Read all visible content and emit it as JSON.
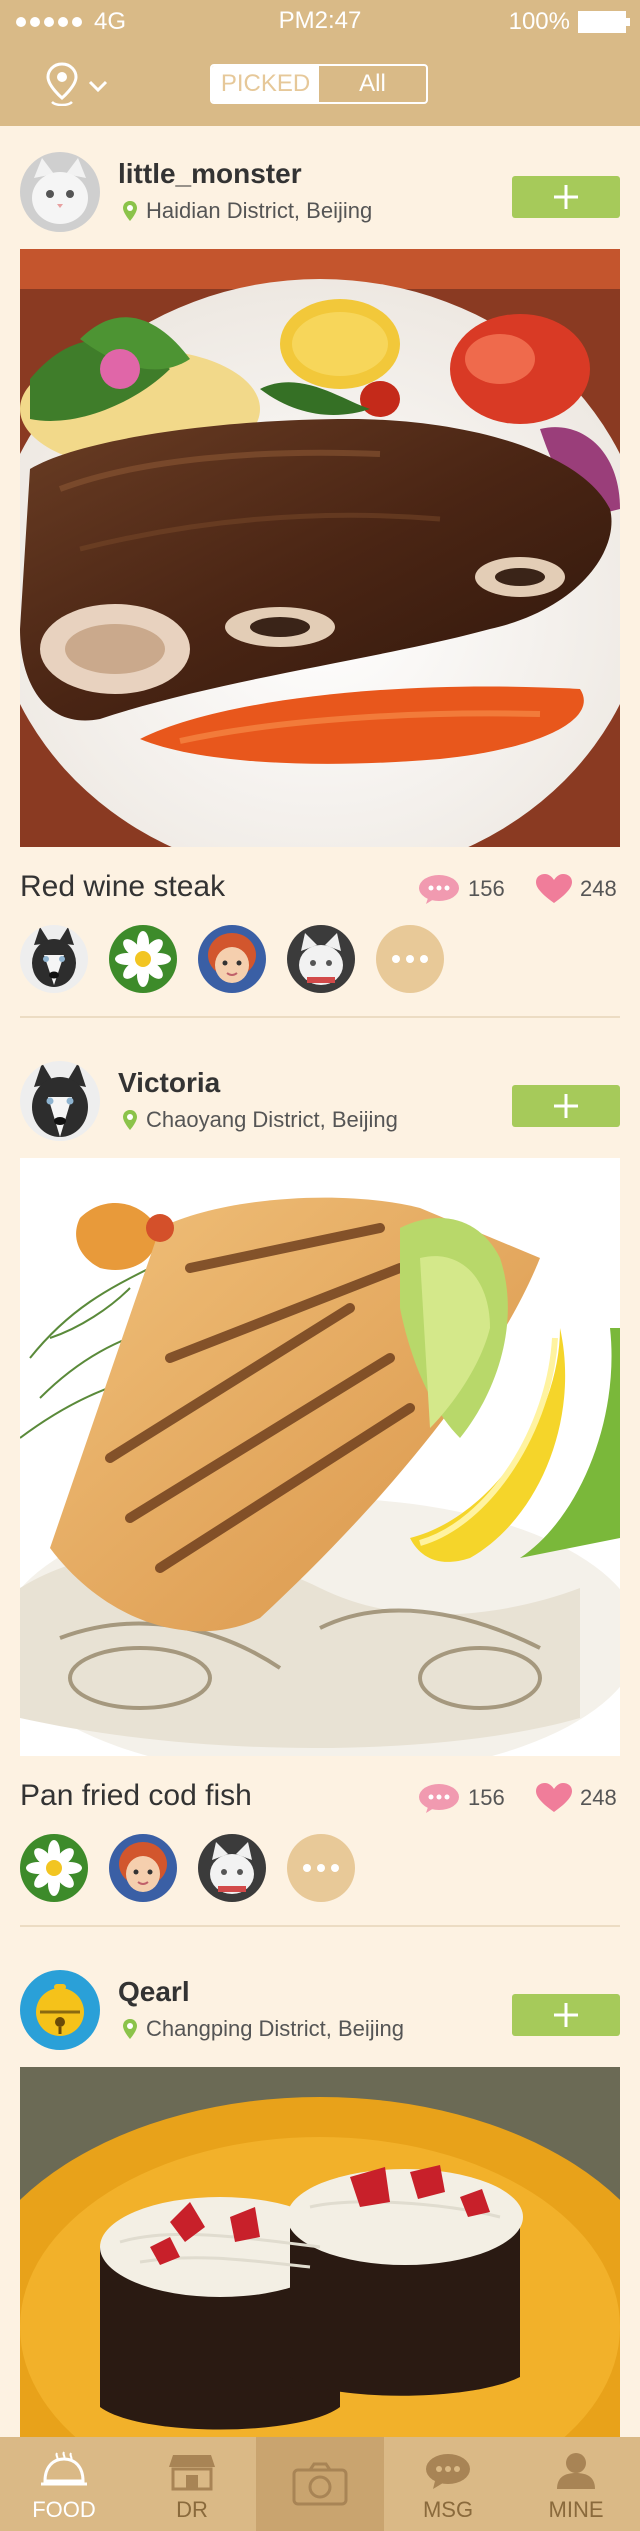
{
  "status_bar": {
    "network": "4G",
    "time": "PM2:47",
    "battery": "100%"
  },
  "header": {
    "location_icon": "map-pin-icon",
    "segments": [
      "PICKED",
      "All"
    ],
    "active_segment": "PICKED"
  },
  "feed": [
    {
      "username": "little_monster",
      "location": "Haidian District, Beijing",
      "dish": "Red wine steak",
      "comments": "156",
      "likes": "248",
      "liker_avatars": [
        "husky-avatar",
        "daisy-avatar",
        "child-avatar",
        "cat-avatar"
      ]
    },
    {
      "username": "Victoria",
      "location": "Chaoyang District, Beijing",
      "dish": "Pan fried cod fish",
      "comments": "156",
      "likes": "248",
      "liker_avatars": [
        "daisy-avatar",
        "child-avatar",
        "cat-avatar"
      ]
    },
    {
      "username": "Qearl",
      "location": "Changping District, Beijing"
    }
  ],
  "tabbar": {
    "items": [
      {
        "label": "FOOD",
        "icon": "food-cloche-icon",
        "active": true
      },
      {
        "label": "DR",
        "icon": "shop-icon",
        "active": false
      },
      {
        "label": "",
        "icon": "camera-icon",
        "active": false
      },
      {
        "label": "MSG",
        "icon": "chat-bubble-icon",
        "active": false
      },
      {
        "label": "MINE",
        "icon": "user-icon",
        "active": false
      }
    ]
  },
  "colors": {
    "header_bg": "#d9ba87",
    "page_bg": "#fdf2e2",
    "follow_green": "#a6ca5a",
    "comment_pink": "#f19ab0",
    "heart_pink": "#f07d9a",
    "location_green": "#8bc34a"
  }
}
